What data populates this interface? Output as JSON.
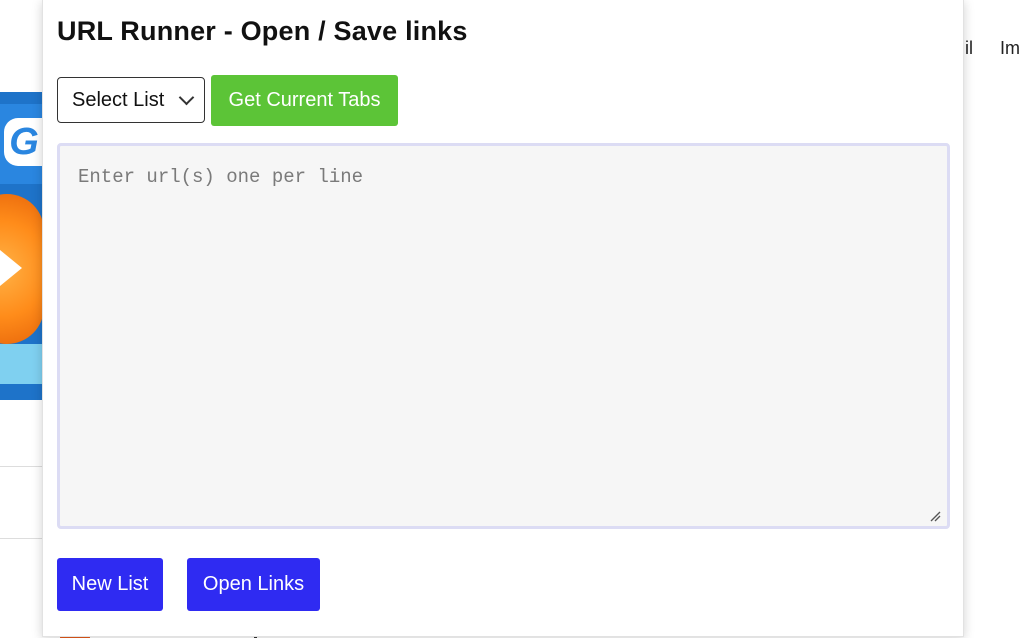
{
  "background_page": {
    "nav_items": [
      "il",
      "Im"
    ],
    "banner_glyph": "G"
  },
  "popup": {
    "title": "URL Runner - Open / Save links",
    "list_select": {
      "selected": "Select List",
      "options": [
        "Select List"
      ]
    },
    "get_tabs_label": "Get Current Tabs",
    "url_input": {
      "placeholder": "Enter url(s) one per line",
      "value": ""
    },
    "new_list_label": "New List",
    "open_links_label": "Open Links"
  },
  "colors": {
    "green_button": "#5cc437",
    "blue_button": "#2f2bf2",
    "textarea_border": "#dcdcf4",
    "textarea_bg": "#f6f6f6"
  },
  "icons": {
    "select_chevron": "chevron-down-icon",
    "textarea_grip": "resize-grip-icon"
  }
}
